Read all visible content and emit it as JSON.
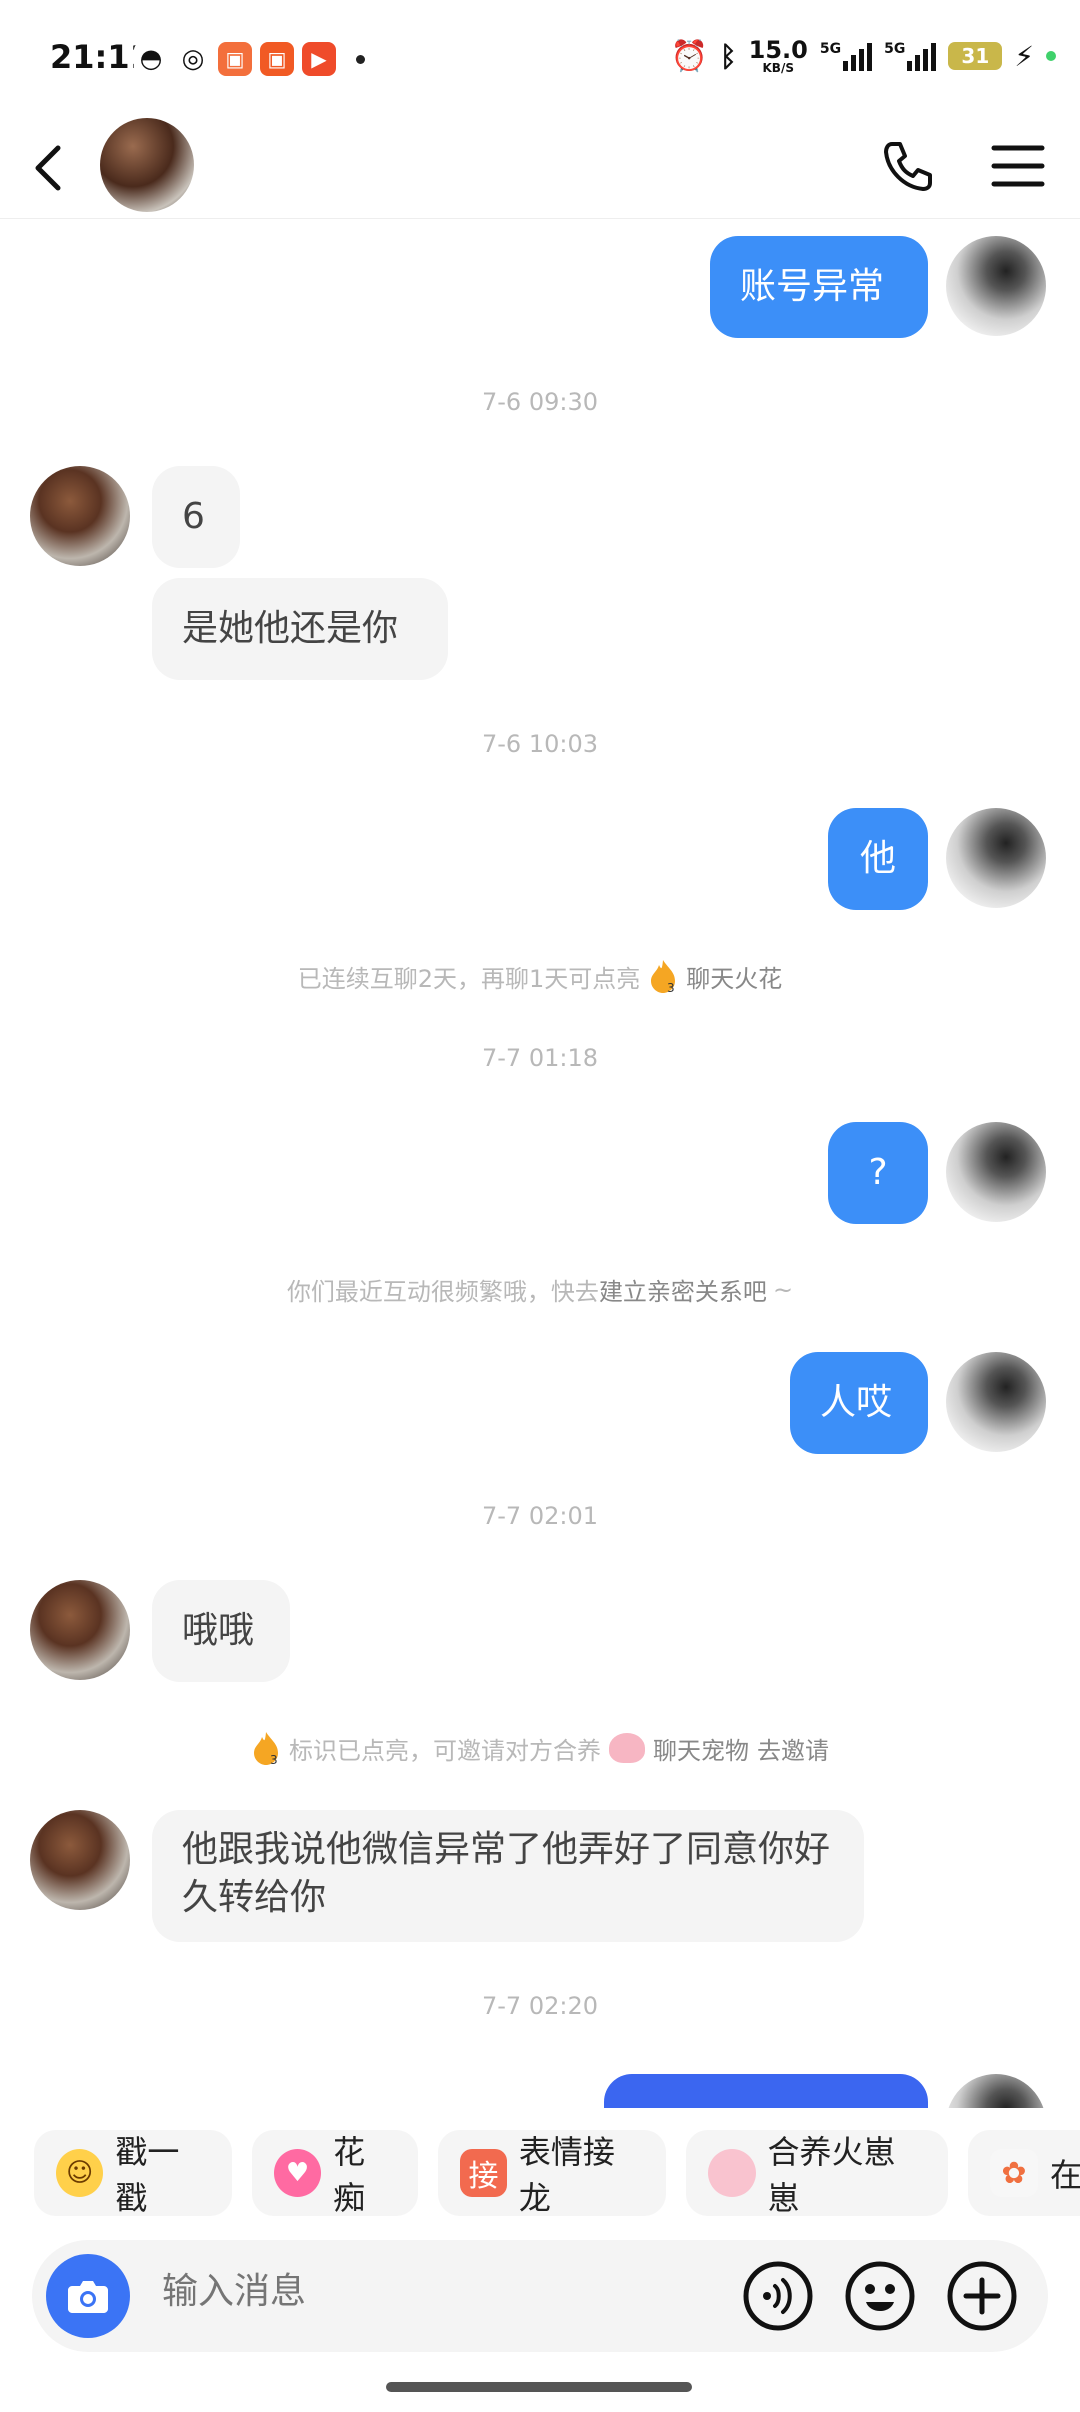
{
  "status_bar": {
    "time": "21:11",
    "speed_value": "15.0",
    "speed_unit": "KB/S",
    "signal_1": "5G",
    "signal_2": "5G",
    "battery": "31"
  },
  "header": {
    "back_icon": "back-arrow-icon",
    "call_icon": "phone-icon",
    "menu_icon": "menu-icon"
  },
  "messages": [
    {
      "side": "me",
      "text": "账号异常"
    },
    {
      "timestamp": "7-6 09:30"
    },
    {
      "side": "other",
      "text": "6"
    },
    {
      "side": "other",
      "text": "是她他还是你"
    },
    {
      "timestamp": "7-6 10:03"
    },
    {
      "side": "me",
      "text": "他"
    },
    {
      "system": "已连续互聊2天，再聊1天可点亮",
      "link": "聊天火花",
      "badge": "3"
    },
    {
      "timestamp": "7-7 01:18"
    },
    {
      "side": "me",
      "text": "?"
    },
    {
      "system_prefix": "你们最近互动很频繁哦，快去",
      "link": "建立亲密关系吧",
      "suffix": "~"
    },
    {
      "side": "me",
      "text": "人哎"
    },
    {
      "timestamp": "7-7 02:01"
    },
    {
      "side": "other",
      "text": "哦哦"
    },
    {
      "system_mid": "标识已点亮，可邀请对方合养",
      "link": "聊天宠物",
      "action": "去邀请",
      "badge": "3"
    },
    {
      "side": "other",
      "text": "他跟我说他微信异常了他弄好了同意你好久转给你"
    },
    {
      "timestamp": "7-7 02:20"
    }
  ],
  "quick_actions": [
    {
      "label": "戳一戳",
      "icon": "poke-emoji-icon"
    },
    {
      "label": "花痴",
      "icon": "heart-eyes-emoji-icon"
    },
    {
      "label": "表情接龙",
      "icon": "jie-emoji-chain-icon",
      "icon_text": "接"
    },
    {
      "label": "合养火崽崽",
      "icon": "pet-icon"
    },
    {
      "label": "在",
      "icon": "spark-icon"
    }
  ],
  "input": {
    "placeholder": "输入消息",
    "camera_icon": "camera-icon",
    "voice_icon": "voice-icon",
    "emoji_icon": "emoji-icon",
    "plus_icon": "plus-icon"
  }
}
